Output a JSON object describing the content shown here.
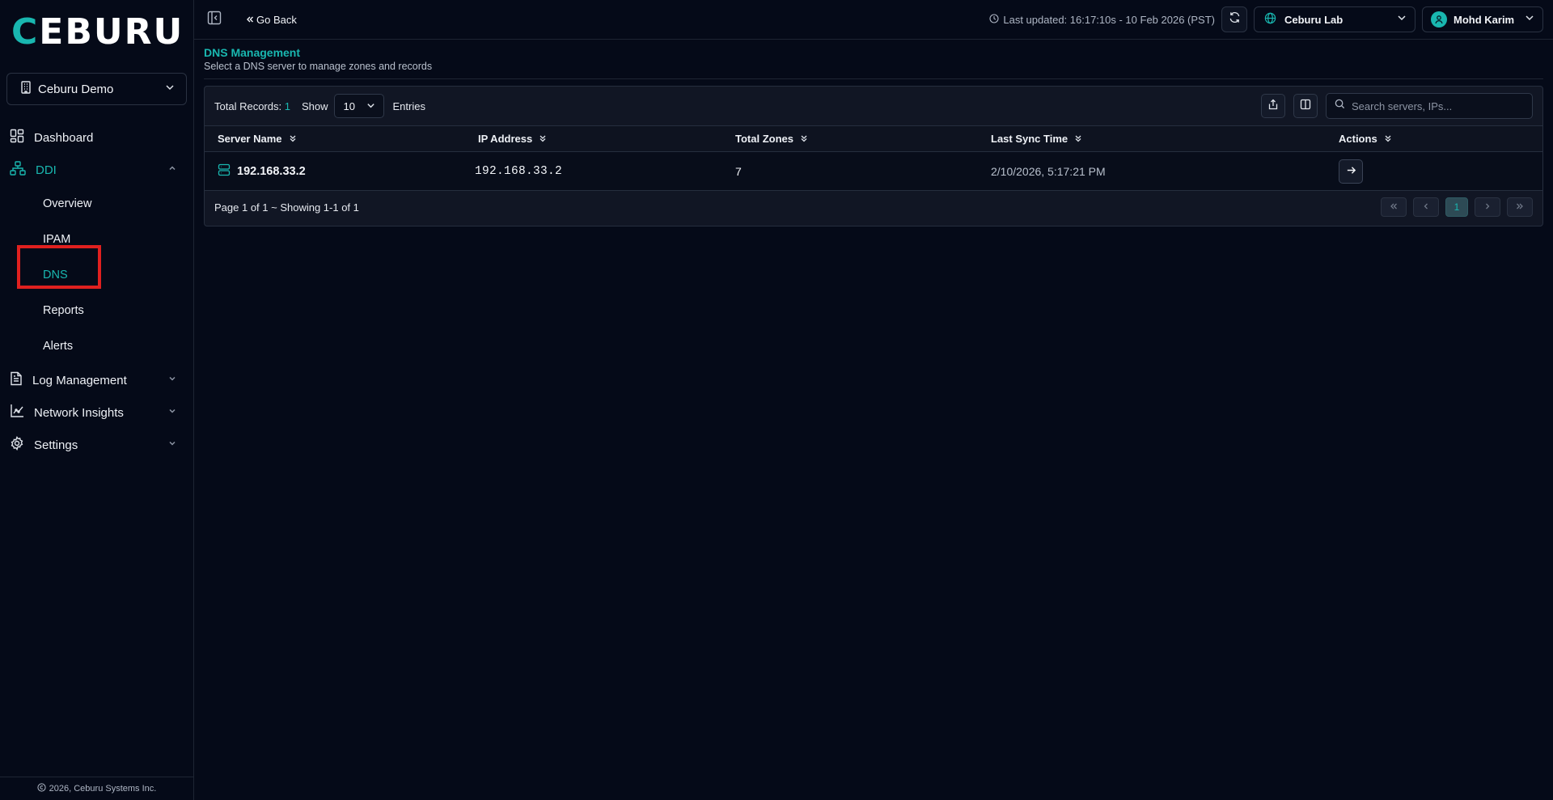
{
  "brand": {
    "logo_first": "C",
    "logo_rest": "EBURU",
    "accent_color": "#19b7b0"
  },
  "tenant": {
    "label": "Ceburu Demo"
  },
  "nav": {
    "dashboard": "Dashboard",
    "ddi": "DDI",
    "ddi_items": [
      "Overview",
      "IPAM",
      "DNS",
      "Reports",
      "Alerts"
    ],
    "log_management": "Log Management",
    "network_insights": "Network Insights",
    "settings": "Settings"
  },
  "footer": {
    "copyright": "2026, Ceburu Systems Inc."
  },
  "topbar": {
    "go_back": "Go Back",
    "last_updated": "Last updated: 16:17:10s - 10 Feb 2026 (PST)",
    "lab": "Ceburu Lab",
    "user": "Mohd Karim"
  },
  "page": {
    "title": "DNS Management",
    "subtitle": "Select a DNS server to manage zones and records"
  },
  "table": {
    "total_label": "Total Records:",
    "total_value": "1",
    "show_label": "Show",
    "page_size": "10",
    "entries_label": "Entries",
    "search_placeholder": "Search servers, IPs...",
    "columns": [
      "Server Name",
      "IP Address",
      "Total Zones",
      "Last Sync Time",
      "Actions"
    ],
    "rows": [
      {
        "server_name": "192.168.33.2",
        "ip": "192.168.33.2",
        "zones": "7",
        "last_sync": "2/10/2026, 5:17:21 PM"
      }
    ],
    "page_info": "Page 1 of 1 ~ Showing 1-1 of 1",
    "current_page": "1"
  }
}
